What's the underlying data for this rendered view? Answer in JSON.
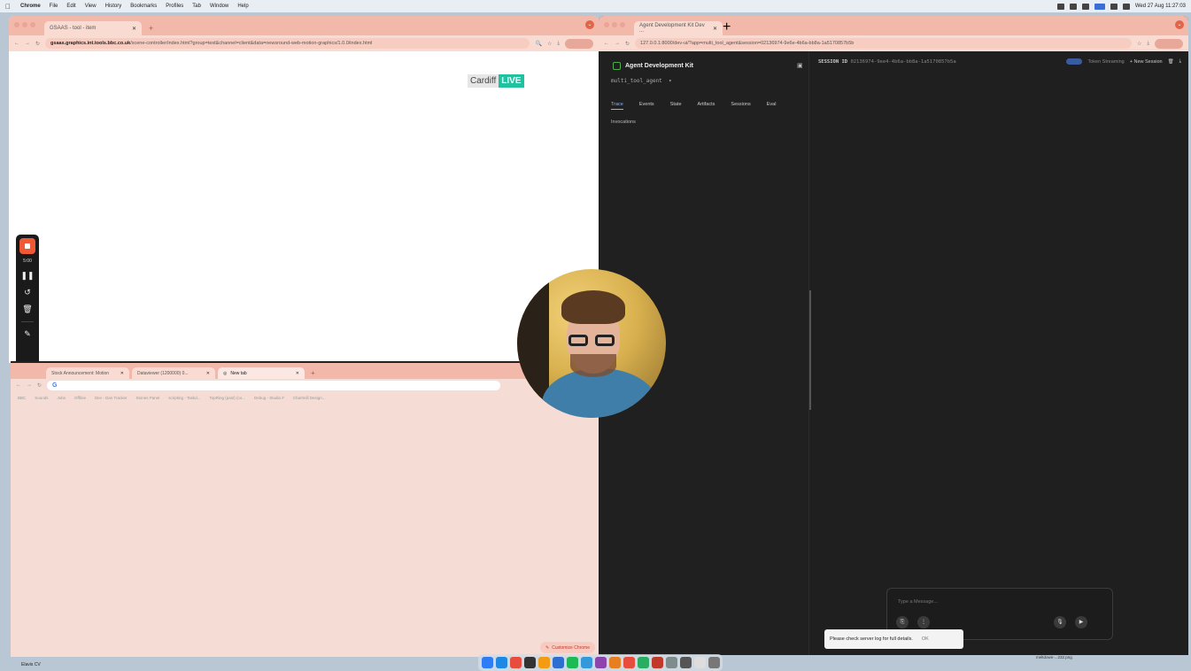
{
  "menubar": {
    "app": "Chrome",
    "items": [
      "File",
      "Edit",
      "View",
      "History",
      "Bookmarks",
      "Profiles",
      "Tab",
      "Window",
      "Help"
    ],
    "clock": "Wed 27 Aug 11:27:03"
  },
  "left_browser": {
    "tab_title": "GSAAS - tool - item",
    "url_host": "gsaas.graphics.int.tools.bbc.co.uk",
    "url_path": "/scene-controller/index.html?group=test&channel=client&data=newsround-web-motion-graphics/1.0.0/index.html",
    "cardiff_text": "Cardiff",
    "live_text": "LIVE"
  },
  "recorder": {
    "time": "5:00"
  },
  "bottom_browser": {
    "tabs": [
      "Stock Announcement: Motion",
      "Dataviewer (1200000) 0...",
      "New tab"
    ],
    "omnibox_icon": "G",
    "bookmarks": [
      "BBC",
      "Sounds",
      "Jobs",
      "Offline",
      "Dev - Dan Tracker",
      "Stories Panel",
      "scripting - Taskd...",
      "TopRing (past) (co...",
      "Debug - Studio #",
      "Chartmill Design..."
    ],
    "customize_label": "Customize Chrome"
  },
  "adk_browser": {
    "tab_title": "Agent Development Kit Dev ...",
    "url": "127.0.0.1:8000/dev-ui/?app=multi_tool_agent&session=02136974-9e6e-4b6a-bb8a-1a5170857b5b",
    "title": "Agent Development Kit",
    "agent": "multi_tool_agent",
    "tabs": [
      "Trace",
      "Events",
      "State",
      "Artifacts",
      "Sessions",
      "Eval"
    ],
    "invocations_label": "Invocations",
    "session_label": "SESSION ID",
    "session_id": "02136974-9ee4-4b6a-bb8a-1a5170857b5a",
    "token_streaming": "Token Streaming",
    "new_session": "+ New Session",
    "message_placeholder": "Type a Message...",
    "snackbar_text": "Please check server log for full details.",
    "snackbar_ok": "OK"
  },
  "taskbar": {
    "left_label": "Elavis CV",
    "right_label": "meltdown-...232.png"
  }
}
